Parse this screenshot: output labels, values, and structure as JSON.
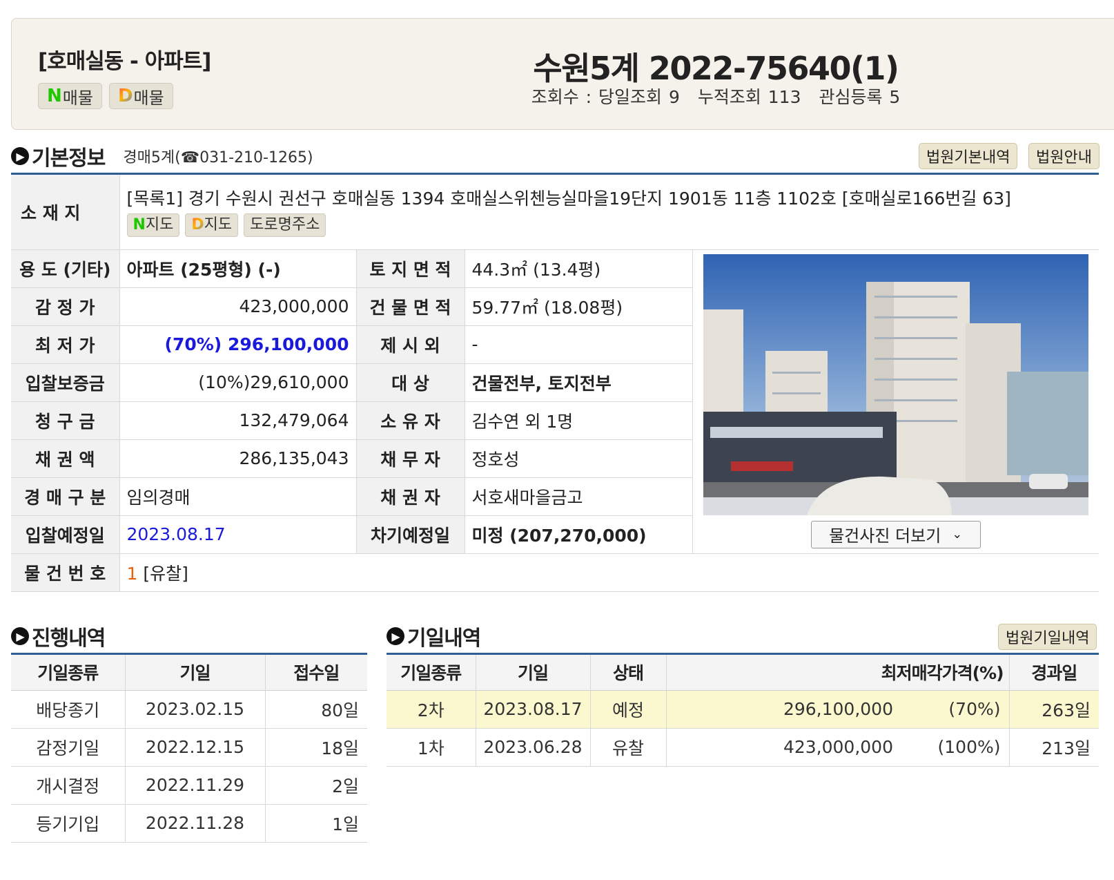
{
  "header": {
    "category": "[호매실동 - 아파트]",
    "naver_prefix": "N",
    "naver_label": "매물",
    "daum_prefix": "D",
    "daum_label": "매물",
    "case_title": "수원5계 2022-75640(1)",
    "views_today": "조회수 : 당일조회 9",
    "views_total": "누적조회 113",
    "interest": "관심등록 5"
  },
  "basic": {
    "title": "기본정보",
    "court_info": "경매5계(☎031-210-1265)",
    "btn_court_basic": "법원기본내역",
    "btn_court_guide": "법원안내",
    "address_label": "소 재 지",
    "address": "[목록1] 경기 수원시 권선구 호매실동 1394 호매실스위첸능실마을19단지 1901동 11층 1102호 [호매실로166번길 63]",
    "map_n_prefix": "N",
    "map_n_label": "지도",
    "map_d_prefix": "D",
    "map_d_label": "지도",
    "road_addr_label": "도로명주소",
    "usage_label": "용 도 (기타)",
    "usage": "아파트 (25평형) (-)",
    "land_label": "토 지 면 적",
    "land": "44.3㎡ (13.4평)",
    "appraisal_label": "감 정 가",
    "appraisal": "423,000,000",
    "building_label": "건 물 면 적",
    "building": "59.77㎡ (18.08평)",
    "min_label": "최 저 가",
    "min_price": "(70%) 296,100,000",
    "excl_label": "제 시 외",
    "excl": "-",
    "deposit_label": "입찰보증금",
    "deposit": "(10%)29,610,000",
    "target_label": "대 상",
    "target": "건물전부, 토지전부",
    "claim_label": "청 구 금",
    "claim": "132,479,064",
    "owner_label": "소 유 자",
    "owner": "김수연 외 1명",
    "bond_label": "채 권 액",
    "bond": "286,135,043",
    "debtor_label": "채 무 자",
    "debtor": "정호성",
    "type_label": "경 매 구 분",
    "type": "임의경매",
    "creditor_label": "채 권 자",
    "creditor": "서호새마을금고",
    "bid_date_label": "입찰예정일",
    "bid_date": "2023.08.17",
    "next_label": "차기예정일",
    "next": "미정 (207,270,000)",
    "item_no_label": "물 건 번 호",
    "item_no": "1",
    "item_status": "[유찰]",
    "more_photos": "물건사진 더보기"
  },
  "progress": {
    "title": "진행내역",
    "headers": [
      "기일종류",
      "기일",
      "접수일"
    ],
    "rows": [
      [
        "배당종기",
        "2023.02.15",
        "80일"
      ],
      [
        "감정기일",
        "2022.12.15",
        "18일"
      ],
      [
        "개시결정",
        "2022.11.29",
        "2일"
      ],
      [
        "등기기입",
        "2022.11.28",
        "1일"
      ]
    ]
  },
  "schedule": {
    "title": "기일내역",
    "btn": "법원기일내역",
    "headers": [
      "기일종류",
      "기일",
      "상태",
      "최저매각가격(%)",
      "경과일"
    ],
    "rows": [
      [
        "2차",
        "2023.08.17",
        "예정",
        "296,100,000",
        "(70%)",
        "263일"
      ],
      [
        "1차",
        "2023.06.28",
        "유찰",
        "423,000,000",
        "(100%)",
        "213일"
      ]
    ]
  }
}
